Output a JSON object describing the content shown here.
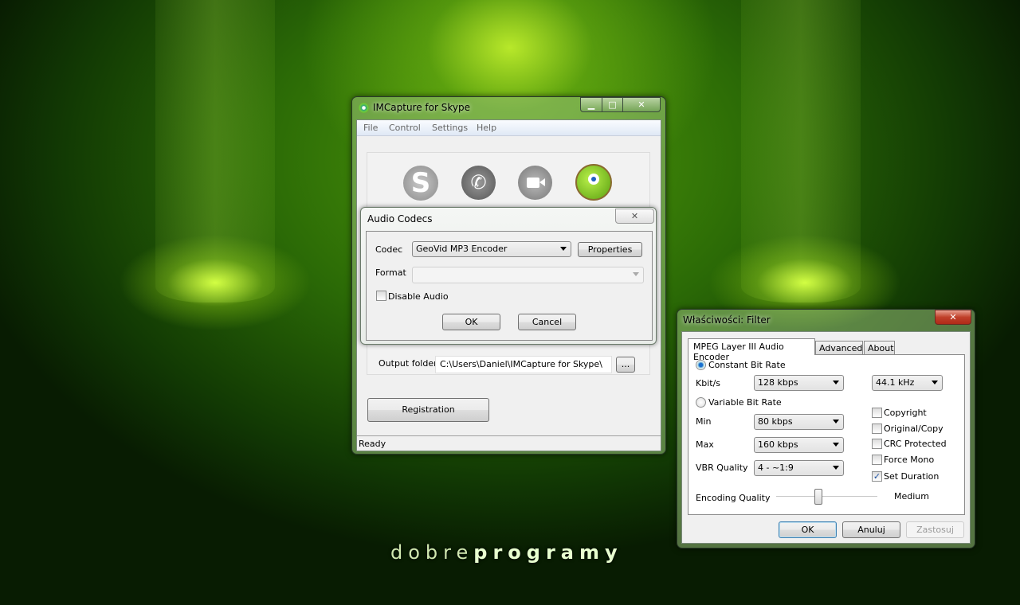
{
  "brand": {
    "part1": "dobre",
    "part2": "programy"
  },
  "imcapture": {
    "title": "IMCapture for Skype",
    "menu": [
      "File",
      "Control",
      "Settings",
      "Help"
    ],
    "output_label": "Output folder:",
    "output_value": "C:\\Users\\Daniel\\IMCapture for Skype\\",
    "browse_label": "...",
    "registration_label": "Registration",
    "status": "Ready"
  },
  "audio_codecs": {
    "title": "Audio Codecs",
    "codec_label": "Codec",
    "codec_value": "GeoVid MP3 Encoder",
    "properties_label": "Properties",
    "format_label": "Format",
    "format_value": "",
    "disable_audio_label": "Disable Audio",
    "disable_audio_checked": false,
    "ok_label": "OK",
    "cancel_label": "Cancel"
  },
  "filter": {
    "title": "Właściwości: Filter",
    "tabs": [
      "MPEG Layer III Audio Encoder",
      "Advanced",
      "About"
    ],
    "cbr_label": "Constant Bit Rate",
    "kbits_label": "Kbit/s",
    "kbits_value": "128 kbps",
    "freq_value": "44.1 kHz",
    "vbr_label": "Variable Bit Rate",
    "min_label": "Min",
    "min_value": "80 kbps",
    "max_label": "Max",
    "max_value": "160 kbps",
    "vbrq_label": "VBR Quality",
    "vbrq_value": "4 - ~1:9",
    "checks": [
      {
        "label": "Copyright",
        "checked": false
      },
      {
        "label": "Original/Copy",
        "checked": false
      },
      {
        "label": "CRC Protected",
        "checked": false
      },
      {
        "label": "Force Mono",
        "checked": false
      },
      {
        "label": "Set Duration",
        "checked": true
      }
    ],
    "encq_label": "Encoding Quality",
    "encq_value": "Medium",
    "encq_fraction": 0.42,
    "ok_label": "OK",
    "cancel_label": "Anuluj",
    "apply_label": "Zastosuj"
  }
}
